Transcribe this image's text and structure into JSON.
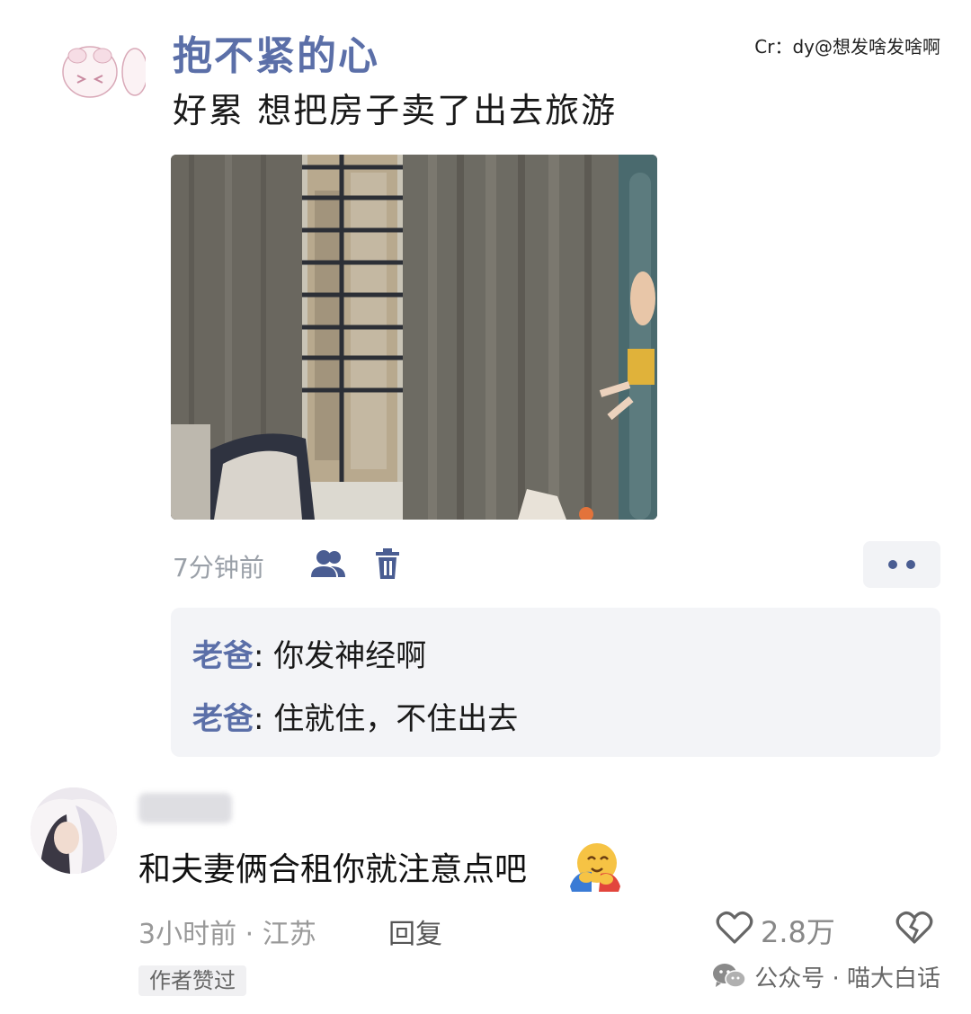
{
  "post": {
    "author": "抱不紧的心",
    "credit": "Cr：dy@想发啥发啥啊",
    "text": "好累 想把房子卖了出去旅游",
    "time": "7分钟前",
    "icons": [
      "friends-icon",
      "trash-icon",
      "more-icon"
    ],
    "replies": [
      {
        "who": "老爸",
        "sep": ":",
        "text": "你发神经啊"
      },
      {
        "who": "老爸",
        "sep": ":",
        "text": "住就住，不住出去"
      }
    ]
  },
  "comment": {
    "text": "和夫妻俩合租你就注意点吧",
    "emoji": "hugging-face-icon",
    "meta": "3小时前 · 江苏",
    "reply_label": "回复",
    "likes": "2.8万",
    "author_liked": "作者赞过"
  },
  "watermark": {
    "text": "公众号 · 喵大白话"
  },
  "colors": {
    "accent": "#5b6fa8",
    "reply_bg": "#f3f4f7",
    "muted": "#999999"
  }
}
